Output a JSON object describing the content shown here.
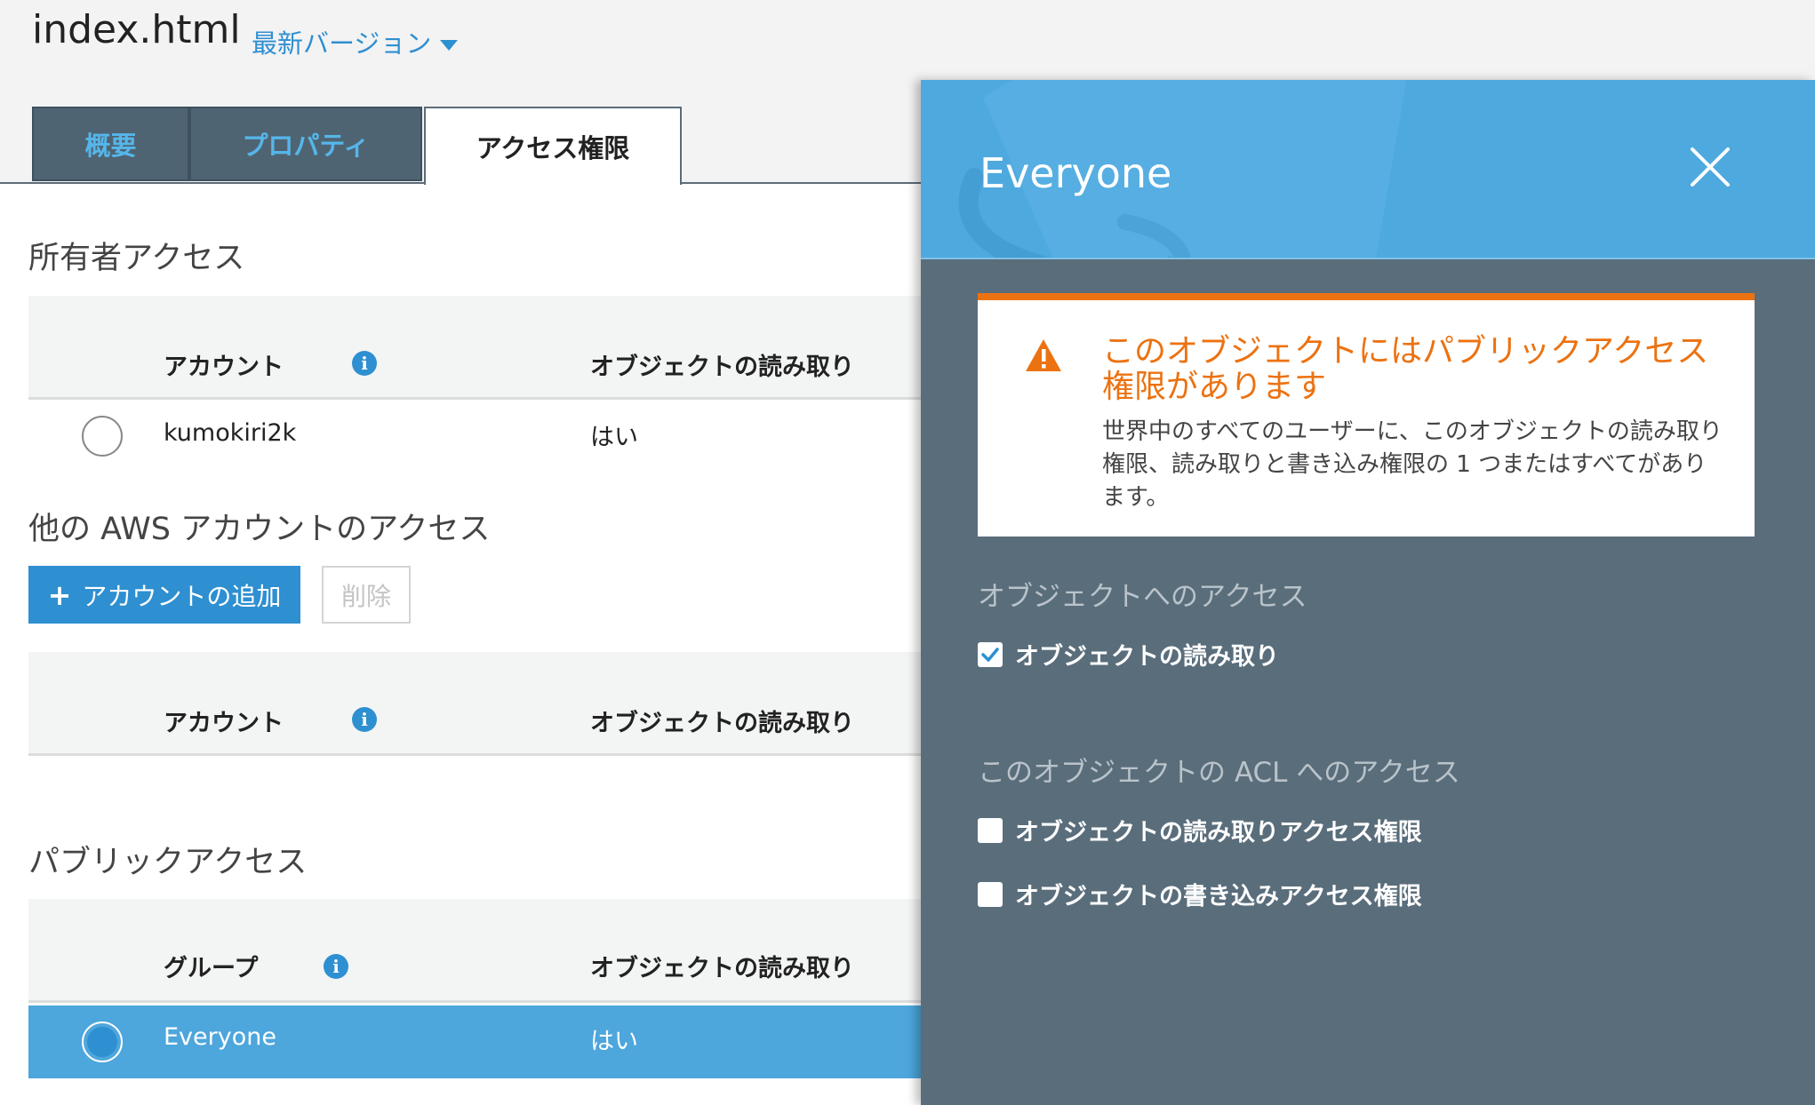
{
  "header": {
    "file_name": "index.html",
    "version_label": "最新バージョン"
  },
  "tabs": [
    {
      "label": "概要",
      "active": false
    },
    {
      "label": "プロパティ",
      "active": false
    },
    {
      "label": "アクセス権限",
      "active": true
    }
  ],
  "owner_access": {
    "title": "所有者アクセス",
    "columns": [
      "アカウント",
      "オブジェクトの読み取り"
    ],
    "rows": [
      {
        "account": "kumokiri2k",
        "read": "はい"
      }
    ]
  },
  "other_accounts": {
    "title": "他の AWS アカウントのアクセス",
    "add_button": "アカウントの追加",
    "delete_button": "削除",
    "columns": [
      "アカウント",
      "オブジェクトの読み取り"
    ]
  },
  "public_access": {
    "title": "パブリックアクセス",
    "columns": [
      "グループ",
      "オブジェクトの読み取り"
    ],
    "rows": [
      {
        "group": "Everyone",
        "read": "はい",
        "selected": true
      }
    ]
  },
  "panel": {
    "title": "Everyone",
    "warning": {
      "title": "このオブジェクトにはパブリックアクセス権限があります",
      "body": "世界中のすべてのユーザーに、このオブジェクトの読み取り権限、読み取りと書き込み権限の 1 つまたはすべてがあります。"
    },
    "object_access": {
      "title": "オブジェクトへのアクセス",
      "options": [
        {
          "label": "オブジェクトの読み取り",
          "checked": true
        }
      ]
    },
    "acl_access": {
      "title": "このオブジェクトの ACL へのアクセス",
      "options": [
        {
          "label": "オブジェクトの読み取りアクセス権限",
          "checked": false
        },
        {
          "label": "オブジェクトの書き込みアクセス権限",
          "checked": false
        }
      ]
    }
  },
  "colors": {
    "accent": "#2e8fd1",
    "panel_header": "#4ea9df",
    "panel_body": "#5a6d7b",
    "warning": "#ec7211",
    "tab_dark": "#4f6473"
  },
  "icons": [
    "caret-down-icon",
    "info-icon",
    "plus-icon",
    "close-icon",
    "warning-icon",
    "check-icon"
  ]
}
